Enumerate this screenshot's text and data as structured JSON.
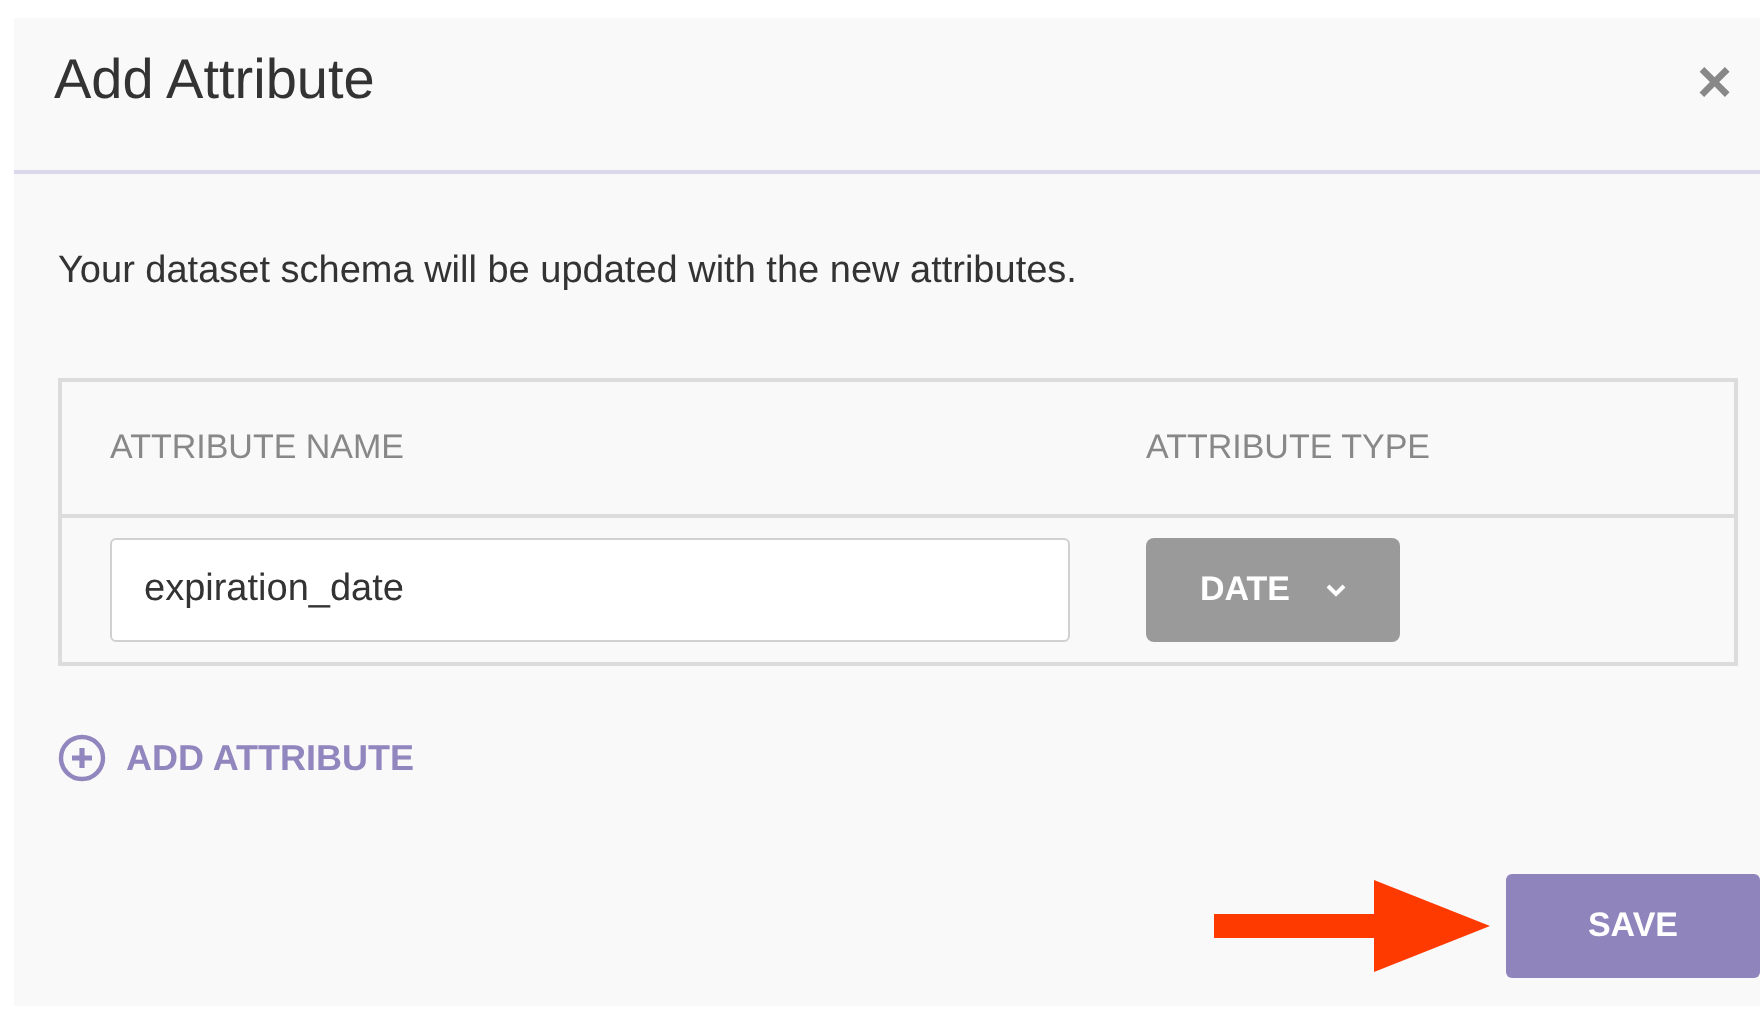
{
  "dialog": {
    "title": "Add Attribute",
    "close": "×"
  },
  "description": "Your dataset schema will be updated with the new attributes.",
  "table": {
    "columns": [
      "ATTRIBUTE NAME",
      "ATTRIBUTE TYPE"
    ],
    "rows": [
      {
        "name": "expiration_date",
        "type": "DATE"
      }
    ]
  },
  "add_link": "ADD ATTRIBUTE",
  "buttons": [
    {
      "label": "SAVE",
      "kind": "primary"
    }
  ]
}
